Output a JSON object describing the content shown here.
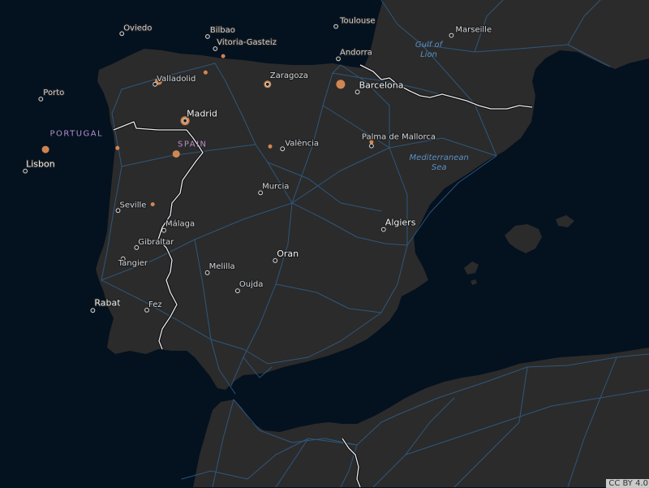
{
  "map": {
    "cities": [
      {
        "name": "Toulouse",
        "lon": 1.44,
        "lat": 43.6
      },
      {
        "name": "Marseille",
        "lon": 5.37,
        "lat": 43.3
      },
      {
        "name": "Oviedo",
        "lon": -5.85,
        "lat": 43.36
      },
      {
        "name": "Bilbao",
        "lon": -2.93,
        "lat": 43.26
      },
      {
        "name": "Vitoria-Gasteiz",
        "lon": -2.67,
        "lat": 42.85
      },
      {
        "name": "Andorra",
        "lon": 1.52,
        "lat": 42.51
      },
      {
        "name": "Valladolid",
        "lon": -4.72,
        "lat": 41.65
      },
      {
        "name": "Zaragoza",
        "lon": -0.89,
        "lat": 41.65
      },
      {
        "name": "Barcelona",
        "lon": 2.17,
        "lat": 41.39,
        "major": true
      },
      {
        "name": "Porto",
        "lon": -8.61,
        "lat": 41.15
      },
      {
        "name": "Madrid",
        "lon": -3.7,
        "lat": 40.42,
        "major": true
      },
      {
        "name": "Palma de Mallorca",
        "lon": 2.65,
        "lat": 39.57
      },
      {
        "name": "València",
        "lon": -0.38,
        "lat": 39.47
      },
      {
        "name": "Lisbon",
        "lon": -9.14,
        "lat": 38.72,
        "major": true
      },
      {
        "name": "Murcia",
        "lon": -1.13,
        "lat": 37.99
      },
      {
        "name": "Seville",
        "lon": -5.98,
        "lat": 37.39
      },
      {
        "name": "Málaga",
        "lon": -4.42,
        "lat": 36.72
      },
      {
        "name": "Gibraltar",
        "lon": -5.35,
        "lat": 36.14
      },
      {
        "name": "Algiers",
        "lon": 3.06,
        "lat": 36.75,
        "major": true
      },
      {
        "name": "Tangier",
        "lon": -5.81,
        "lat": 35.76
      },
      {
        "name": "Oran",
        "lon": -0.63,
        "lat": 35.7,
        "major": true
      },
      {
        "name": "Melilla",
        "lon": -2.94,
        "lat": 35.29
      },
      {
        "name": "Oujda",
        "lon": -1.91,
        "lat": 34.68
      },
      {
        "name": "Rabat",
        "lon": -6.84,
        "lat": 34.02,
        "major": true
      },
      {
        "name": "Fez",
        "lon": -5.0,
        "lat": 34.03
      }
    ],
    "country_labels": [
      {
        "name": "PORTUGAL",
        "lon": -8.3,
        "lat": 39.9
      },
      {
        "name": "SPAIN",
        "lon": -3.95,
        "lat": 39.55
      }
    ],
    "sea_labels": [
      {
        "lines": [
          "Gulf of",
          "Lion"
        ],
        "lon": 4.6,
        "lat": 42.9
      },
      {
        "lines": [
          "Mediterranean",
          "Sea"
        ],
        "lon": 4.95,
        "lat": 39.1
      }
    ],
    "markers": [
      {
        "lon": -5.85,
        "lat": 43.36,
        "size": 1
      },
      {
        "lon": -2.4,
        "lat": 42.6,
        "size": 1
      },
      {
        "lon": -3.0,
        "lat": 42.05,
        "size": 1
      },
      {
        "lon": -4.6,
        "lat": 41.75,
        "size": 2
      },
      {
        "lon": -0.89,
        "lat": 41.65,
        "size": 2
      },
      {
        "lon": 1.6,
        "lat": 41.65,
        "size": 3
      },
      {
        "lon": 1.52,
        "lat": 42.51,
        "size": 1
      },
      {
        "lon": -3.7,
        "lat": 40.42,
        "size": 3
      },
      {
        "lon": -6.0,
        "lat": 39.5,
        "size": 1
      },
      {
        "lon": -8.45,
        "lat": 39.45,
        "size": 2
      },
      {
        "lon": -4.0,
        "lat": 39.3,
        "size": 2
      },
      {
        "lon": -0.8,
        "lat": 39.55,
        "size": 1
      },
      {
        "lon": 2.65,
        "lat": 39.7,
        "size": 1
      },
      {
        "lon": -4.8,
        "lat": 37.6,
        "size": 1
      }
    ],
    "colors": {
      "ocean": "#04111f",
      "land": "#2b2b2b",
      "road": "#2f5c86",
      "border": "#e8e8ee",
      "marker": "#e39055"
    },
    "attribution": "CC BY 4.0"
  }
}
